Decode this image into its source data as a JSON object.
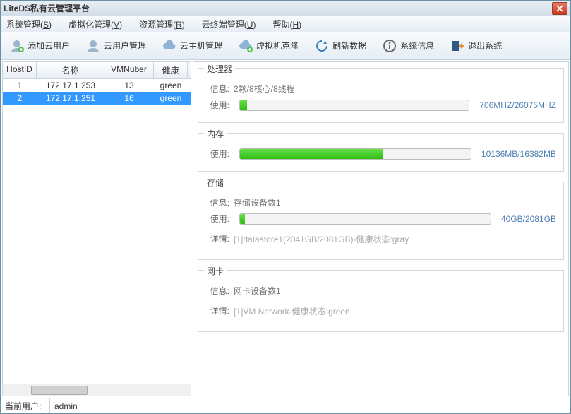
{
  "title": "LiteDS私有云管理平台",
  "menu": {
    "system": "系统管理",
    "system_m": "S",
    "virt": "虚拟化管理",
    "virt_m": "V",
    "resource": "资源管理",
    "resource_m": "R",
    "cloudterm": "云终端管理",
    "cloudterm_m": "U",
    "help": "帮助",
    "help_m": "H"
  },
  "toolbar": {
    "add_user": "添加云用户",
    "user_mgmt": "云用户管理",
    "host_mgmt": "云主机管理",
    "vm_clone": "虚拟机克隆",
    "refresh": "刷新数据",
    "sysinfo": "系统信息",
    "exit": "退出系统"
  },
  "hostTable": {
    "headers": {
      "host": "HostID",
      "name": "名称",
      "vm": "VMNuber",
      "health": "健康"
    },
    "rows": [
      {
        "host": "1",
        "name": "172.17.1.253",
        "vm": "13",
        "health": "green",
        "selected": false
      },
      {
        "host": "2",
        "name": "172.17.1.251",
        "vm": "16",
        "health": "green",
        "selected": true
      }
    ]
  },
  "cpu": {
    "title": "处理器",
    "info_label": "信息:",
    "info": "2颗/8核心/8线程",
    "use_label": "使用:",
    "percent": 3,
    "right": "706MHZ/26075MHZ"
  },
  "mem": {
    "title": "内存",
    "use_label": "使用:",
    "percent": 62,
    "right": "10136MB/16382MB"
  },
  "storage": {
    "title": "存储",
    "info_label": "信息:",
    "info": "存储设备数1",
    "use_label": "使用:",
    "percent": 2,
    "right": "40GB/2081GB",
    "detail_label": "详情:",
    "detail": "[1]datastore1(2041GB/2081GB)-健康状态:gray"
  },
  "nic": {
    "title": "网卡",
    "info_label": "信息:",
    "info": "网卡设备数1",
    "detail_label": "详情:",
    "detail": "[1]VM Network-健康状态:green"
  },
  "status": {
    "user_label": "当前用户:",
    "user": "admin"
  }
}
